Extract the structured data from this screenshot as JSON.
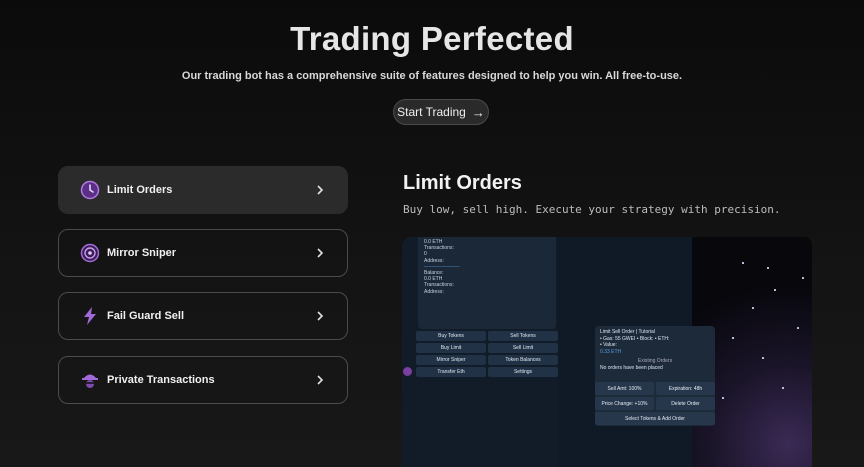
{
  "hero": {
    "title": "Trading Perfected",
    "subtitle": "Our trading bot has a comprehensive suite of features designed to help you win. All free-to-use.",
    "cta_label": "Start Trading"
  },
  "features": [
    {
      "label": "Limit Orders",
      "icon": "clock-icon",
      "active": true
    },
    {
      "label": "Mirror Sniper",
      "icon": "target-icon",
      "active": false
    },
    {
      "label": "Fail Guard Sell",
      "icon": "lightning-icon",
      "active": false
    },
    {
      "label": "Private Transactions",
      "icon": "spy-icon",
      "active": false
    }
  ],
  "detail": {
    "title": "Limit Orders",
    "description": "Buy low, sell high. Execute your strategy with precision."
  },
  "preview": {
    "message_lines": [
      "0.0 ETH",
      "Transactions:",
      "0",
      "Address:",
      "Balance:",
      "0.0 ETH",
      "Transactions:",
      "Address:"
    ],
    "keyboard": [
      "Buy Tokens",
      "Sell Tokens",
      "Buy Limit",
      "Sell Limit",
      "Mirror Sniper",
      "Token Balances",
      "Transfer Eth",
      "Settings"
    ],
    "popup": {
      "title": "Limit Sell Order | Tutorial",
      "gas_line": "• Gas: 55 GWEI • Block: • ETH:",
      "value_line": "• Value:",
      "value": "0.33 ETH",
      "existing_header": "Existing Orders",
      "empty_text": "No orders have been placed",
      "buttons": [
        "Sell Amt: 100%",
        "Expiration: 48h",
        "Price Change: +10%",
        "Delete Order",
        "Select Tokens & Add Order"
      ]
    }
  },
  "colors": {
    "accent_purple": "#a26ad8",
    "background": "#111111",
    "active_row": "#2b2b2b"
  }
}
